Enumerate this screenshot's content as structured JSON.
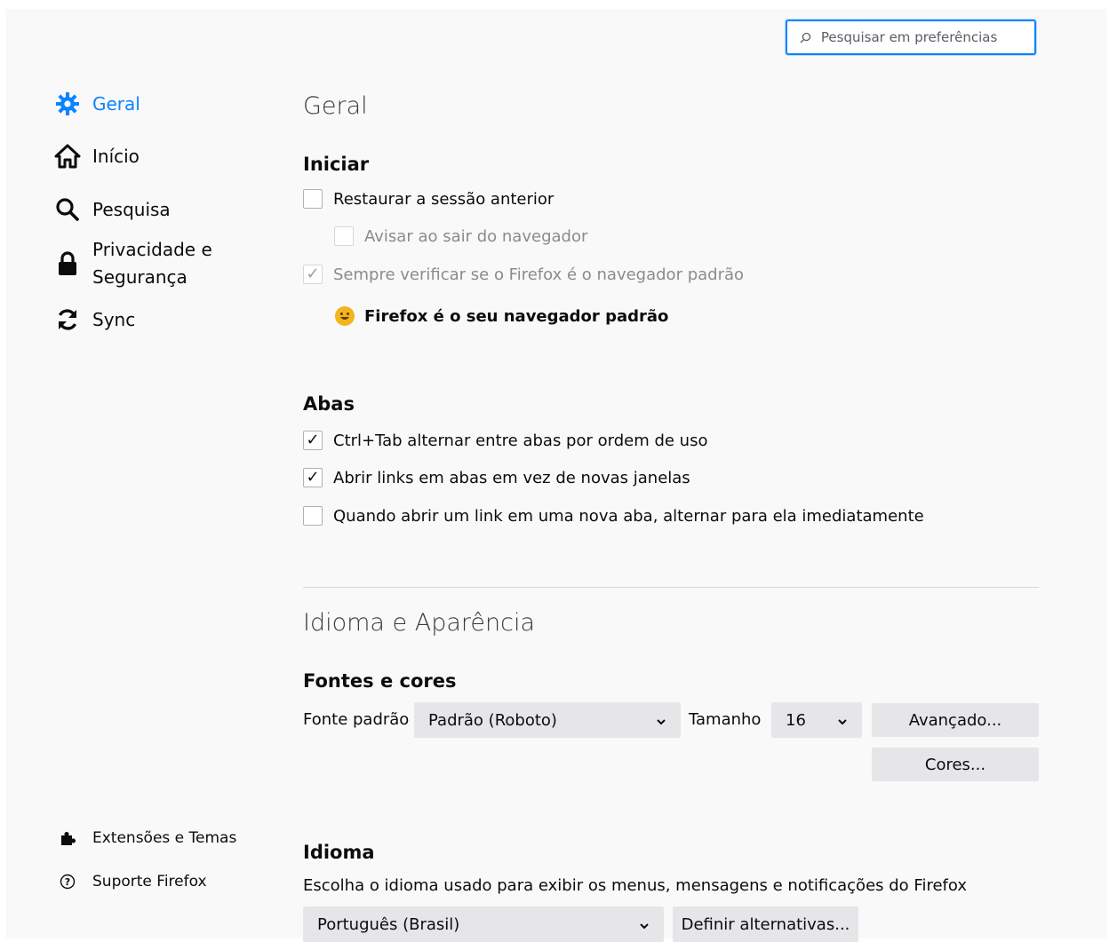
{
  "search": {
    "placeholder": "Pesquisar em preferências"
  },
  "sidebar": {
    "items": [
      {
        "label": "Geral",
        "icon": "gear-icon",
        "active": true
      },
      {
        "label": "Início",
        "icon": "home-icon"
      },
      {
        "label": "Pesquisa",
        "icon": "search-icon"
      },
      {
        "label_line1": "Privacidade e",
        "label_line2": "Segurança",
        "icon": "lock-icon"
      },
      {
        "label": "Sync",
        "icon": "sync-icon"
      }
    ],
    "footer": [
      {
        "label": "Extensões e Temas",
        "icon": "puzzle-icon"
      },
      {
        "label": "Suporte Firefox",
        "icon": "help-icon"
      }
    ]
  },
  "main": {
    "title": "Geral",
    "startup": {
      "heading": "Iniciar",
      "restore_session": {
        "label": "Restaurar a sessão anterior",
        "checked": false
      },
      "warn_on_quit": {
        "label": "Avisar ao sair do navegador",
        "checked": false,
        "disabled": true
      },
      "always_check_default": {
        "label": "Sempre verificar se o Firefox é o navegador padrão",
        "checked": true,
        "disabled": true
      },
      "default_status": "Firefox é o seu navegador padrão"
    },
    "tabs": {
      "heading": "Abas",
      "ctrl_tab": {
        "label": "Ctrl+Tab alternar entre abas por ordem de uso",
        "checked": true
      },
      "open_links_in_tabs": {
        "label": "Abrir links em abas em vez de novas janelas",
        "checked": true
      },
      "switch_to_new_tab": {
        "label": "Quando abrir um link em uma nova aba, alternar para ela imediatamente",
        "checked": false
      }
    },
    "language_appearance": {
      "title": "Idioma e Aparência",
      "fonts_heading": "Fontes e cores",
      "default_font_label": "Fonte padrão",
      "default_font_value": "Padrão (Roboto)",
      "size_label": "Tamanho",
      "size_value": "16",
      "advanced_button": "Avançado...",
      "colors_button": "Cores..."
    },
    "language": {
      "heading": "Idioma",
      "description": "Escolha o idioma usado para exibir os menus, mensagens e notificações do Firefox",
      "selected": "Português (Brasil)",
      "alternatives_button": "Definir alternativas..."
    }
  },
  "colors": {
    "accent": "#0a84ff",
    "background": "#f9f9fa",
    "button": "#e6e6e9"
  }
}
